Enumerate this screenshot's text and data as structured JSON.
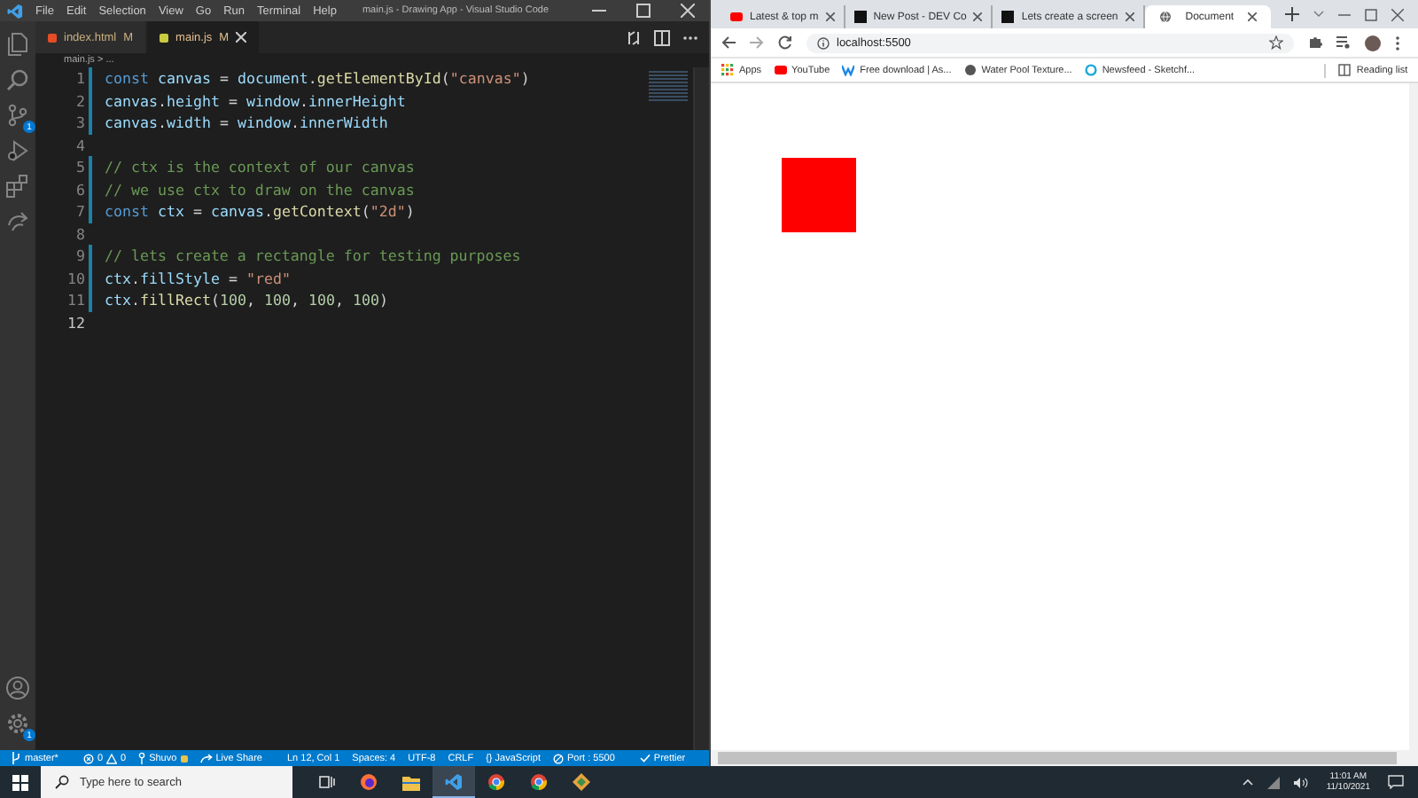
{
  "editor_window": {
    "menu": [
      "File",
      "Edit",
      "Selection",
      "View",
      "Go",
      "Run",
      "Terminal",
      "Help"
    ],
    "title": "main.js - Drawing App - Visual Studio Code",
    "source_control_badge": "1",
    "settings_badge": "1",
    "tabs": [
      {
        "label": "index.html",
        "status": "M",
        "selected": false
      },
      {
        "label": "main.js",
        "status": "M",
        "selected": true
      }
    ],
    "breadcrumb": "main.js > ...",
    "lines": [
      {
        "number": "1",
        "current": false,
        "changed": true,
        "tokens": [
          {
            "kind": "kw",
            "text": "const"
          },
          {
            "kind": "var",
            "text": " canvas"
          },
          {
            "kind": "plain",
            "text": " = "
          },
          {
            "kind": "var",
            "text": "document"
          },
          {
            "kind": "plain",
            "text": "."
          },
          {
            "kind": "fn",
            "text": "getElementById"
          },
          {
            "kind": "plain",
            "text": "("
          },
          {
            "kind": "str",
            "text": "\"canvas\""
          },
          {
            "kind": "plain",
            "text": ")"
          }
        ]
      },
      {
        "number": "2",
        "current": false,
        "changed": true,
        "tokens": [
          {
            "kind": "var",
            "text": "canvas"
          },
          {
            "kind": "plain",
            "text": "."
          },
          {
            "kind": "var",
            "text": "height"
          },
          {
            "kind": "plain",
            "text": " = "
          },
          {
            "kind": "var",
            "text": "window"
          },
          {
            "kind": "plain",
            "text": "."
          },
          {
            "kind": "var",
            "text": "innerHeight"
          }
        ]
      },
      {
        "number": "3",
        "current": false,
        "changed": true,
        "tokens": [
          {
            "kind": "var",
            "text": "canvas"
          },
          {
            "kind": "plain",
            "text": "."
          },
          {
            "kind": "var",
            "text": "width"
          },
          {
            "kind": "plain",
            "text": " = "
          },
          {
            "kind": "var",
            "text": "window"
          },
          {
            "kind": "plain",
            "text": "."
          },
          {
            "kind": "var",
            "text": "innerWidth"
          }
        ]
      },
      {
        "number": "4",
        "current": false,
        "changed": false
      },
      {
        "number": "5",
        "current": false,
        "changed": true,
        "tokens": [
          {
            "kind": "cmt",
            "text": "// ctx is the context of our canvas"
          }
        ]
      },
      {
        "number": "6",
        "current": false,
        "changed": true,
        "tokens": [
          {
            "kind": "cmt",
            "text": "// we use ctx to draw on the canvas"
          }
        ]
      },
      {
        "number": "7",
        "current": false,
        "changed": true,
        "tokens": [
          {
            "kind": "kw",
            "text": "const"
          },
          {
            "kind": "var",
            "text": " ctx"
          },
          {
            "kind": "plain",
            "text": " = "
          },
          {
            "kind": "var",
            "text": "canvas"
          },
          {
            "kind": "plain",
            "text": "."
          },
          {
            "kind": "fn",
            "text": "getContext"
          },
          {
            "kind": "plain",
            "text": "("
          },
          {
            "kind": "str",
            "text": "\"2d\""
          },
          {
            "kind": "plain",
            "text": ")"
          }
        ]
      },
      {
        "number": "8",
        "current": false,
        "changed": false
      },
      {
        "number": "9",
        "current": false,
        "changed": true,
        "tokens": [
          {
            "kind": "cmt",
            "text": "// lets create a rectangle for testing purposes"
          }
        ]
      },
      {
        "number": "10",
        "current": false,
        "changed": true,
        "tokens": [
          {
            "kind": "var",
            "text": "ctx"
          },
          {
            "kind": "plain",
            "text": "."
          },
          {
            "kind": "var",
            "text": "fillStyle"
          },
          {
            "kind": "plain",
            "text": " = "
          },
          {
            "kind": "str",
            "text": "\"red\""
          }
        ]
      },
      {
        "number": "11",
        "current": false,
        "changed": true,
        "tokens": [
          {
            "kind": "var",
            "text": "ctx"
          },
          {
            "kind": "plain",
            "text": "."
          },
          {
            "kind": "fn",
            "text": "fillRect"
          },
          {
            "kind": "plain",
            "text": "("
          },
          {
            "kind": "num",
            "text": "100"
          },
          {
            "kind": "plain",
            "text": ", "
          },
          {
            "kind": "num",
            "text": "100"
          },
          {
            "kind": "plain",
            "text": ", "
          },
          {
            "kind": "num",
            "text": "100"
          },
          {
            "kind": "plain",
            "text": ", "
          },
          {
            "kind": "num",
            "text": "100"
          },
          {
            "kind": "plain",
            "text": ")"
          }
        ]
      },
      {
        "number": "12",
        "current": true,
        "changed": false
      }
    ],
    "status_bar": {
      "branch": "master*",
      "errors": "0",
      "warnings": "0",
      "user": "Shuvo",
      "live_share": "Live Share",
      "position": "Ln 12, Col 1",
      "spaces": "Spaces: 4",
      "encoding": "UTF-8",
      "eol": "CRLF",
      "language": "{} JavaScript",
      "port": "Port : 5500",
      "formatter": "Prettier"
    }
  },
  "browser": {
    "tabs": [
      {
        "label": "Latest & top m",
        "selected": false
      },
      {
        "label": "New Post - DEV Co",
        "selected": false
      },
      {
        "label": "Lets create a screen",
        "selected": false
      },
      {
        "label": "Document",
        "selected": true
      }
    ],
    "address": "localhost:5500",
    "bookmarks": [
      "Apps",
      "YouTube",
      "Free download | As...",
      "Water Pool Texture...",
      "Newsfeed - Sketchf..."
    ],
    "reading_list": "Reading list"
  },
  "taskbar": {
    "search_placeholder": "Type here to search",
    "time": "11:01 AM",
    "date": "11/10/2021"
  }
}
